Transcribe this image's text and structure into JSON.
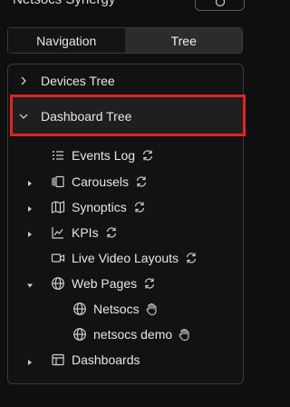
{
  "header": {
    "app_title": "Netsocs Synergy",
    "settings_icon": "gear-icon"
  },
  "tabs": [
    {
      "label": "Navigation",
      "active": false
    },
    {
      "label": "Tree",
      "active": true
    }
  ],
  "tree": {
    "devices_tree": "Devices Tree",
    "dashboard_tree": "Dashboard Tree",
    "items": {
      "events_log": "Events Log",
      "carousels": "Carousels",
      "synoptics": "Synoptics",
      "kpis": "KPIs",
      "live_video_layouts": "Live Video Layouts",
      "web_pages": "Web Pages",
      "netsocs": "Netsocs",
      "netsocs_demo": "netsocs demo",
      "dashboards": "Dashboards"
    }
  },
  "colors": {
    "highlight": "#e02424",
    "background": "#0f0f0f",
    "panel": "#121212"
  }
}
